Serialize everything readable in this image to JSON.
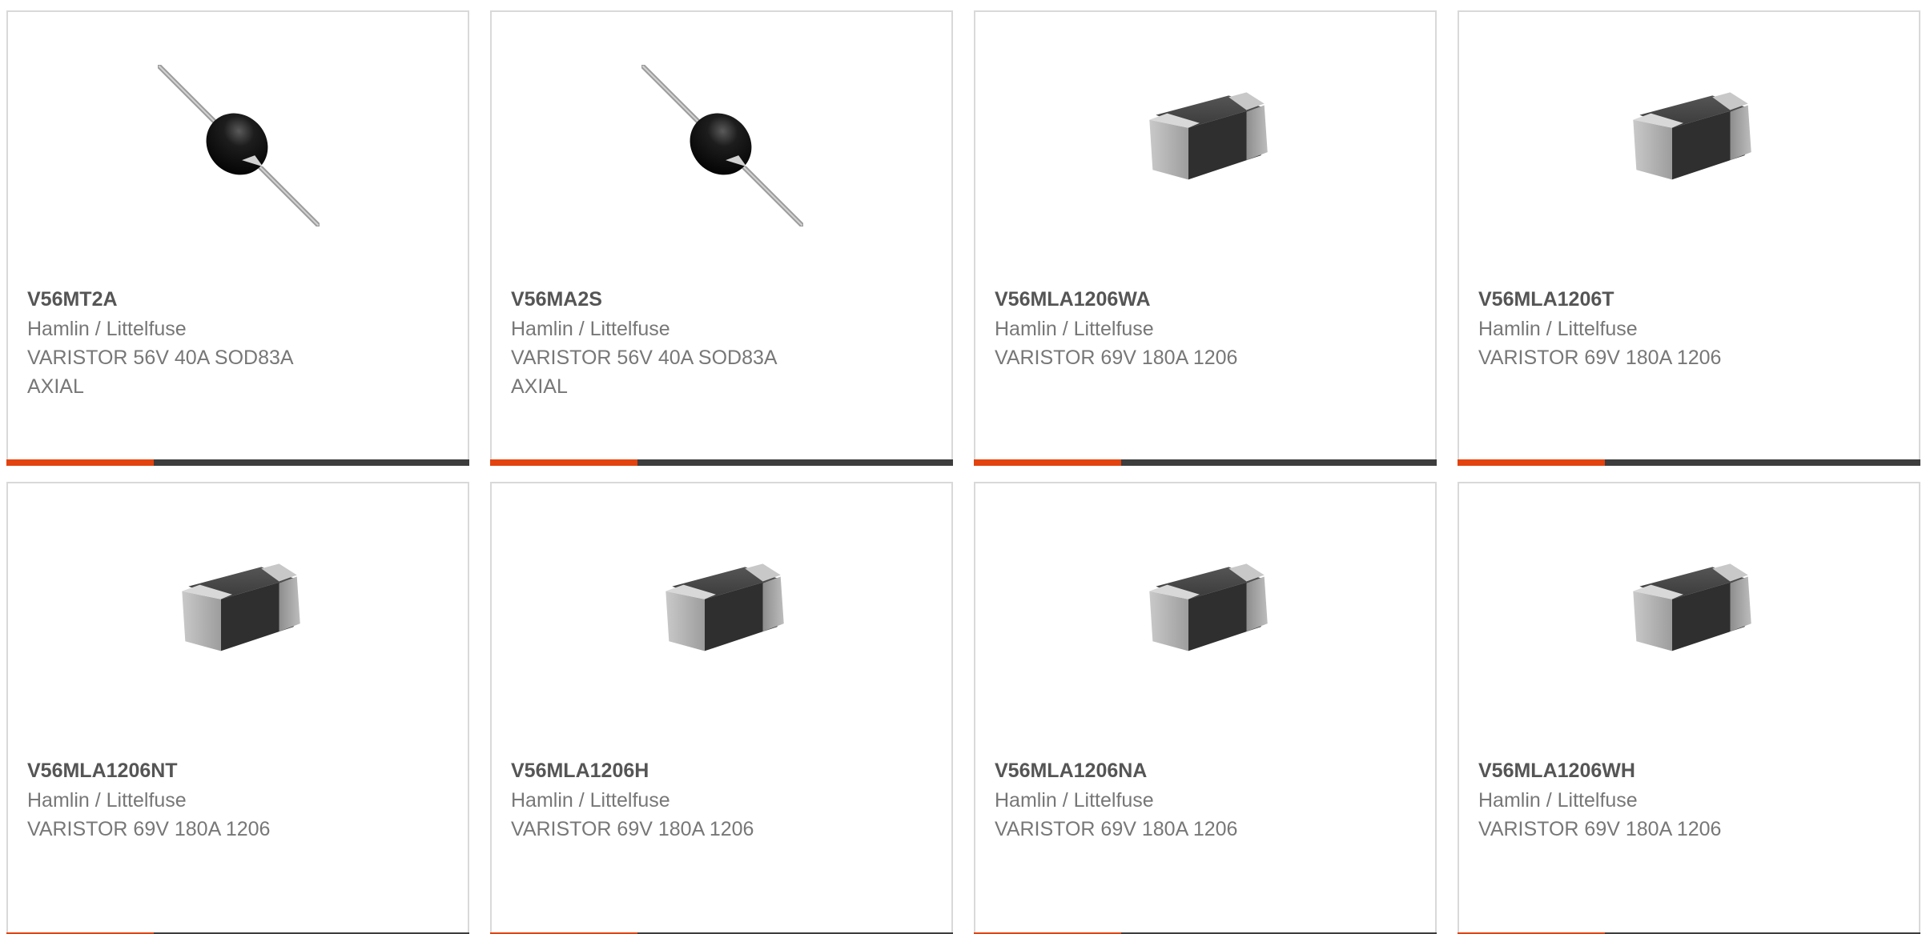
{
  "products": [
    {
      "part": "V56MT2A",
      "maker": "Hamlin / Littelfuse",
      "desc": "VARISTOR 56V 40A SOD83A AXIAL",
      "desc_lines": [
        "VARISTOR 56V 40A SOD83A",
        "AXIAL"
      ],
      "image": "axial-varistor-image"
    },
    {
      "part": "V56MA2S",
      "maker": "Hamlin / Littelfuse",
      "desc": "VARISTOR 56V 40A SOD83A AXIAL",
      "desc_lines": [
        "VARISTOR 56V 40A SOD83A",
        "AXIAL"
      ],
      "image": "axial-varistor-image"
    },
    {
      "part": "V56MLA1206WA",
      "maker": "Hamlin / Littelfuse",
      "desc": "VARISTOR 69V 180A 1206",
      "desc_lines": [
        "VARISTOR 69V 180A 1206"
      ],
      "image": "smd-chip-image"
    },
    {
      "part": "V56MLA1206T",
      "maker": "Hamlin / Littelfuse",
      "desc": "VARISTOR 69V 180A 1206",
      "desc_lines": [
        "VARISTOR 69V 180A 1206"
      ],
      "image": "smd-chip-image"
    },
    {
      "part": "V56MLA1206NT",
      "maker": "Hamlin / Littelfuse",
      "desc": "VARISTOR 69V 180A 1206",
      "desc_lines": [
        "VARISTOR 69V 180A 1206"
      ],
      "image": "smd-chip-image"
    },
    {
      "part": "V56MLA1206H",
      "maker": "Hamlin / Littelfuse",
      "desc": "VARISTOR 69V 180A 1206",
      "desc_lines": [
        "VARISTOR 69V 180A 1206"
      ],
      "image": "smd-chip-image"
    },
    {
      "part": "V56MLA1206NA",
      "maker": "Hamlin / Littelfuse",
      "desc": "VARISTOR 69V 180A 1206",
      "desc_lines": [
        "VARISTOR 69V 180A 1206"
      ],
      "image": "smd-chip-image"
    },
    {
      "part": "V56MLA1206WH",
      "maker": "Hamlin / Littelfuse",
      "desc": "VARISTOR 69V 180A 1206",
      "desc_lines": [
        "VARISTOR 69V 180A 1206"
      ],
      "image": "smd-chip-image"
    }
  ],
  "colors": {
    "accent": "#e2430f",
    "bar": "#3d3d3d",
    "border": "#d9d9d9",
    "part_text": "#555555",
    "body_text": "#777777"
  }
}
